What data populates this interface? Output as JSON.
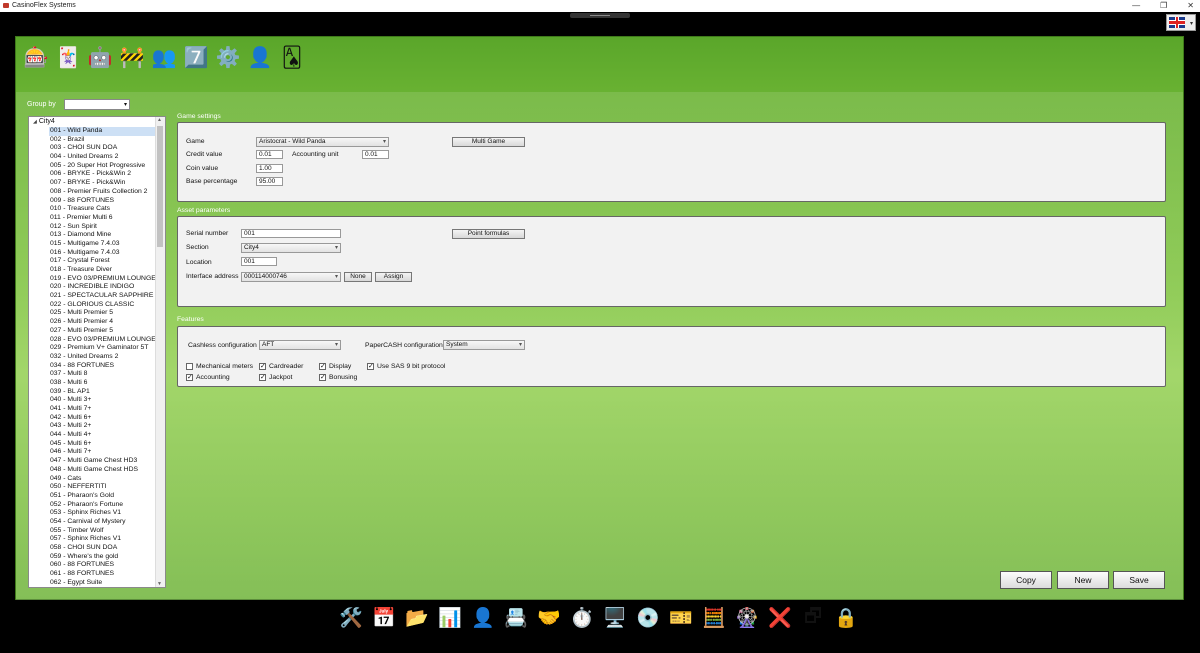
{
  "window": {
    "title": "CasinoFlex Systems",
    "controls": {
      "minimize": "—",
      "restore": "❐",
      "close": "✕"
    },
    "language_flag": "uk-flag-icon"
  },
  "toolbar": {
    "icons": [
      {
        "name": "slot-machine-icon",
        "glyph": "🎰"
      },
      {
        "name": "card-table-icon",
        "glyph": "🃏"
      },
      {
        "name": "gaming-robot-icon",
        "glyph": "🤖"
      },
      {
        "name": "fence-icon",
        "glyph": "🚧"
      },
      {
        "name": "users-icon",
        "glyph": "👥"
      },
      {
        "name": "seven-seven-seven-icon",
        "glyph": "7️⃣"
      },
      {
        "name": "gear-icon",
        "glyph": "⚙️"
      },
      {
        "name": "user-icon",
        "glyph": "👤"
      },
      {
        "name": "playing-cards-icon",
        "glyph": "🂡"
      }
    ]
  },
  "sidebar": {
    "group_by_label": "Group by",
    "group_by_value": "",
    "root": "City4",
    "items": [
      "001 - Wild Panda",
      "002 - Brazil",
      "003 - CHOI SUN DOA",
      "004 - United Dreams 2",
      "005 - 20 Super Hot Progressive",
      "006 - BRYKE - Pick&Win 2",
      "007 - BRYKE - Pick&Win",
      "008 - Premier Fruits Collection 2",
      "009 - 88 FORTUNES",
      "010 - Treasure Cats",
      "011 - Premier Multi 6",
      "012 - Sun Spirit",
      "013 - Diamond Mine",
      "015 - Multigame 7.4.03",
      "016 - Multigame 7.4.03",
      "017 - Crystal Forest",
      "018 - Treasure Diver",
      "019 - EVO 03/PREMIUM LOUNGE/",
      "020 - INCREDIBLE INDIGO",
      "021 - SPECTACULAR SAPPHIRE",
      "022 - GLORIOUS CLASSIC",
      "025 - Multi Premier 5",
      "026 - Multi Premier 4",
      "027 - Multi Premier 5",
      "028 - EVO 03/PREMIUM LOUNGE/",
      "029 - Premium V+ Gaminator 5T",
      "032 - United Dreams 2",
      "034 - 88 FORTUNES",
      "037 - Multi 8",
      "038 - Multi 6",
      "039 - BL AP1",
      "040 - Multi 3+",
      "041 - Multi 7+",
      "042 - Multi 6+",
      "043 - Multi 2+",
      "044 - Multi 4+",
      "045 - Multi 6+",
      "046 - Multi 7+",
      "047 - Multi Game Chest HD3",
      "048 - Multi Game Chest HDS",
      "049 - Cats",
      "050 - NEFFERTITI",
      "051 - Pharaon's Gold",
      "052 - Pharaon's Fortune",
      "053 - Sphinx Riches V1",
      "054 - Carnival of Mystery",
      "055 - Timber Wolf",
      "057 - Sphinx Riches V1",
      "058 - CHOI SUN DOA",
      "059 - Where's the gold",
      "060 - 88 FORTUNES",
      "061 - 88 FORTUNES",
      "062 - Egypt Suite"
    ]
  },
  "game_settings": {
    "title": "Game settings",
    "game_label": "Game",
    "game_value": "Aristocrat - Wild Panda",
    "credit_value_label": "Credit value",
    "credit_value": "0.01",
    "accounting_unit_label": "Accounting unit",
    "accounting_unit": "0.01",
    "coin_value_label": "Coin value",
    "coin_value": "1.00",
    "base_percentage_label": "Base percentage",
    "base_percentage": "95.00",
    "multi_game_button": "Multi Game"
  },
  "asset_parameters": {
    "title": "Asset parameters",
    "serial_number_label": "Serial number",
    "serial_number": "001",
    "section_label": "Section",
    "section_value": "City4",
    "location_label": "Location",
    "location_value": "001",
    "interface_address_label": "Interface address",
    "interface_address_value": "000114000746",
    "none_button": "None",
    "assign_button": "Assign",
    "point_formulas_button": "Point formulas"
  },
  "features": {
    "title": "Features",
    "cashless_label": "Cashless configuration",
    "cashless_value": "AFT",
    "papercash_label": "PaperCASH configuration",
    "papercash_value": "System",
    "checkboxes": [
      {
        "label": "Mechanical meters",
        "checked": false
      },
      {
        "label": "Cardreader",
        "checked": true
      },
      {
        "label": "Display",
        "checked": true
      },
      {
        "label": "Use SAS 9 bit protocol",
        "checked": true
      },
      {
        "label": "Accounting",
        "checked": true
      },
      {
        "label": "Jackpot",
        "checked": true
      },
      {
        "label": "Bonusing",
        "checked": true
      }
    ]
  },
  "actions": {
    "copy": "Copy",
    "new": "New",
    "save": "Save"
  },
  "taskbar": {
    "icons": [
      {
        "name": "tools-icon",
        "glyph": "🛠️"
      },
      {
        "name": "calendar-icon",
        "glyph": "📅"
      },
      {
        "name": "documents-icon",
        "glyph": "📂"
      },
      {
        "name": "report-chart-icon",
        "glyph": "📊"
      },
      {
        "name": "person-icon",
        "glyph": "👤"
      },
      {
        "name": "contact-card-icon",
        "glyph": "📇"
      },
      {
        "name": "handshake-icon",
        "glyph": "🤝"
      },
      {
        "name": "speedometer-icon",
        "glyph": "⏱️"
      },
      {
        "name": "settings-screen-icon",
        "glyph": "🖥️"
      },
      {
        "name": "database-icon",
        "glyph": "💿"
      },
      {
        "name": "ticket-icon",
        "glyph": "🎫"
      },
      {
        "name": "calculator-icon",
        "glyph": "🧮"
      },
      {
        "name": "roulette-icon",
        "glyph": "🎡"
      },
      {
        "name": "exit-icon",
        "glyph": "❌"
      },
      {
        "name": "windows-icon",
        "glyph": "🗗"
      },
      {
        "name": "lock-document-icon",
        "glyph": "🔒"
      }
    ]
  }
}
